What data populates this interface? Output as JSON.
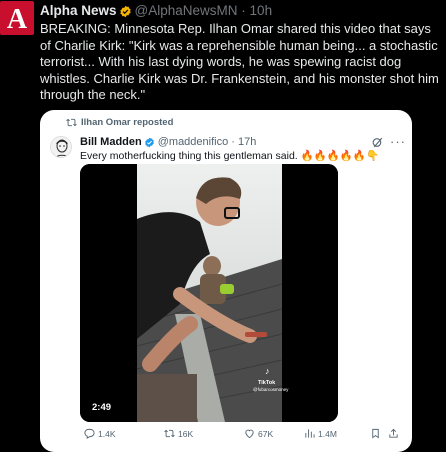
{
  "post": {
    "author_name": "Alpha News",
    "author_handle": "@AlphaNewsMN",
    "separator": "·",
    "time": "10h",
    "text": "BREAKING: Minnesota Rep. Ilhan Omar shared this video that says of Charlie Kirk: \"Kirk was a reprehensible human being... a stochastic terrorist... With his last dying words, he was spewing racist dog whistles. Charlie Kirk was Dr. Frankenstein, and his monster shot him through the neck.\"",
    "avatar_letter": "A",
    "brand_color": "#c8102e"
  },
  "quoted": {
    "reposted_label": "Ilhan Omar reposted",
    "author_name": "Bill Madden",
    "author_handle": "@maddenifico",
    "separator": "·",
    "time": "17h",
    "text": "Every motherfucking thing this gentleman said. 🔥🔥🔥🔥🔥👇",
    "video_duration": "2:49",
    "tiktok_label": "TikTok",
    "tiktok_handle": "@fubarcosmoney",
    "actions": {
      "replies": "1.4K",
      "reposts": "16K",
      "likes": "67K",
      "views": "1.4M"
    }
  },
  "icons": [
    "verified-badge-icon",
    "repost-icon",
    "grok-icon",
    "more-icon",
    "reply-icon",
    "like-icon",
    "views-icon",
    "bookmark-icon",
    "share-icon"
  ],
  "colors": {
    "verified": "#f4b400",
    "muted": "#71767b",
    "card_bg": "#ffffff"
  }
}
